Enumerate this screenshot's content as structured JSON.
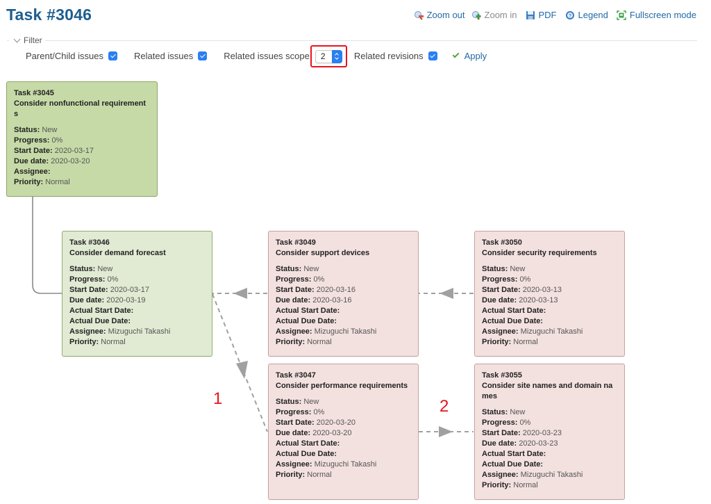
{
  "header": {
    "title": "Task #3046"
  },
  "toolbar": [
    {
      "label": "Zoom out",
      "icon": "zoom-out-icon",
      "enabled": true
    },
    {
      "label": "Zoom in",
      "icon": "zoom-in-icon",
      "enabled": false
    },
    {
      "label": "PDF",
      "icon": "save-disk-icon",
      "enabled": true
    },
    {
      "label": "Legend",
      "icon": "help-icon",
      "enabled": true
    },
    {
      "label": "Fullscreen mode",
      "icon": "fullscreen-icon",
      "enabled": true
    }
  ],
  "filter": {
    "legend": "Filter",
    "parent_child_label": "Parent/Child issues",
    "parent_child_checked": true,
    "related_issues_label": "Related issues",
    "related_issues_checked": true,
    "scope_label": "Related issues scope",
    "scope_value": "2",
    "related_revisions_label": "Related revisions",
    "related_revisions_checked": true,
    "apply_label": "Apply"
  },
  "colors": {
    "title": "#1d5e8f",
    "link": "#2269a5",
    "highlight": "#e8141c",
    "checkbox": "#2a7ff1",
    "parent_card": "#c6daa7",
    "current_card": "#e1ebd3",
    "related_card": "#f3e1e0"
  },
  "field_labels": {
    "status": "Status",
    "progress": "Progress",
    "start_date": "Start Date",
    "due_date": "Due date",
    "actual_start": "Actual Start Date",
    "actual_due": "Actual Due Date",
    "assignee": "Assignee",
    "priority": "Priority"
  },
  "issues": [
    {
      "key": "t3045",
      "id": "Task #3045",
      "subject": "Consider nonfunctional requirements",
      "role": "parent",
      "status": "New",
      "progress": "0%",
      "start_date": "2020-03-17",
      "due_date": "2020-03-20",
      "assignee": "",
      "priority": "Normal"
    },
    {
      "key": "t3046",
      "id": "Task #3046",
      "subject": "Consider demand forecast",
      "role": "current",
      "status": "New",
      "progress": "0%",
      "start_date": "2020-03-17",
      "due_date": "2020-03-19",
      "actual_start": "",
      "actual_due": "",
      "assignee": "Mizuguchi Takashi",
      "priority": "Normal"
    },
    {
      "key": "t3049",
      "id": "Task #3049",
      "subject": "Consider support devices",
      "role": "related",
      "status": "New",
      "progress": "0%",
      "start_date": "2020-03-16",
      "due_date": "2020-03-16",
      "actual_start": "",
      "actual_due": "",
      "assignee": "Mizuguchi Takashi",
      "priority": "Normal"
    },
    {
      "key": "t3050",
      "id": "Task #3050",
      "subject": "Consider security requirements",
      "role": "related",
      "status": "New",
      "progress": "0%",
      "start_date": "2020-03-13",
      "due_date": "2020-03-13",
      "actual_start": "",
      "actual_due": "",
      "assignee": "Mizuguchi Takashi",
      "priority": "Normal"
    },
    {
      "key": "t3047",
      "id": "Task #3047",
      "subject": "Consider performance requirements",
      "role": "related",
      "status": "New",
      "progress": "0%",
      "start_date": "2020-03-20",
      "due_date": "2020-03-20",
      "actual_start": "",
      "actual_due": "",
      "assignee": "Mizuguchi Takashi",
      "priority": "Normal"
    },
    {
      "key": "t3055",
      "id": "Task #3055",
      "subject": "Consider site names and domain names",
      "role": "related",
      "status": "New",
      "progress": "0%",
      "start_date": "2020-03-23",
      "due_date": "2020-03-23",
      "actual_start": "",
      "actual_due": "",
      "assignee": "Mizuguchi Takashi",
      "priority": "Normal"
    }
  ],
  "relations": [
    {
      "from": "t3045",
      "to": "t3046",
      "type": "parent-child"
    },
    {
      "from": "t3049",
      "to": "t3046",
      "type": "precedes"
    },
    {
      "from": "t3050",
      "to": "t3049",
      "type": "precedes"
    },
    {
      "from": "t3046",
      "to": "t3047",
      "type": "precedes"
    },
    {
      "from": "t3047",
      "to": "t3055",
      "type": "precedes"
    }
  ],
  "annotations": [
    {
      "label": "1",
      "near": "t3046-t3047"
    },
    {
      "label": "2",
      "near": "t3047-t3055"
    }
  ]
}
